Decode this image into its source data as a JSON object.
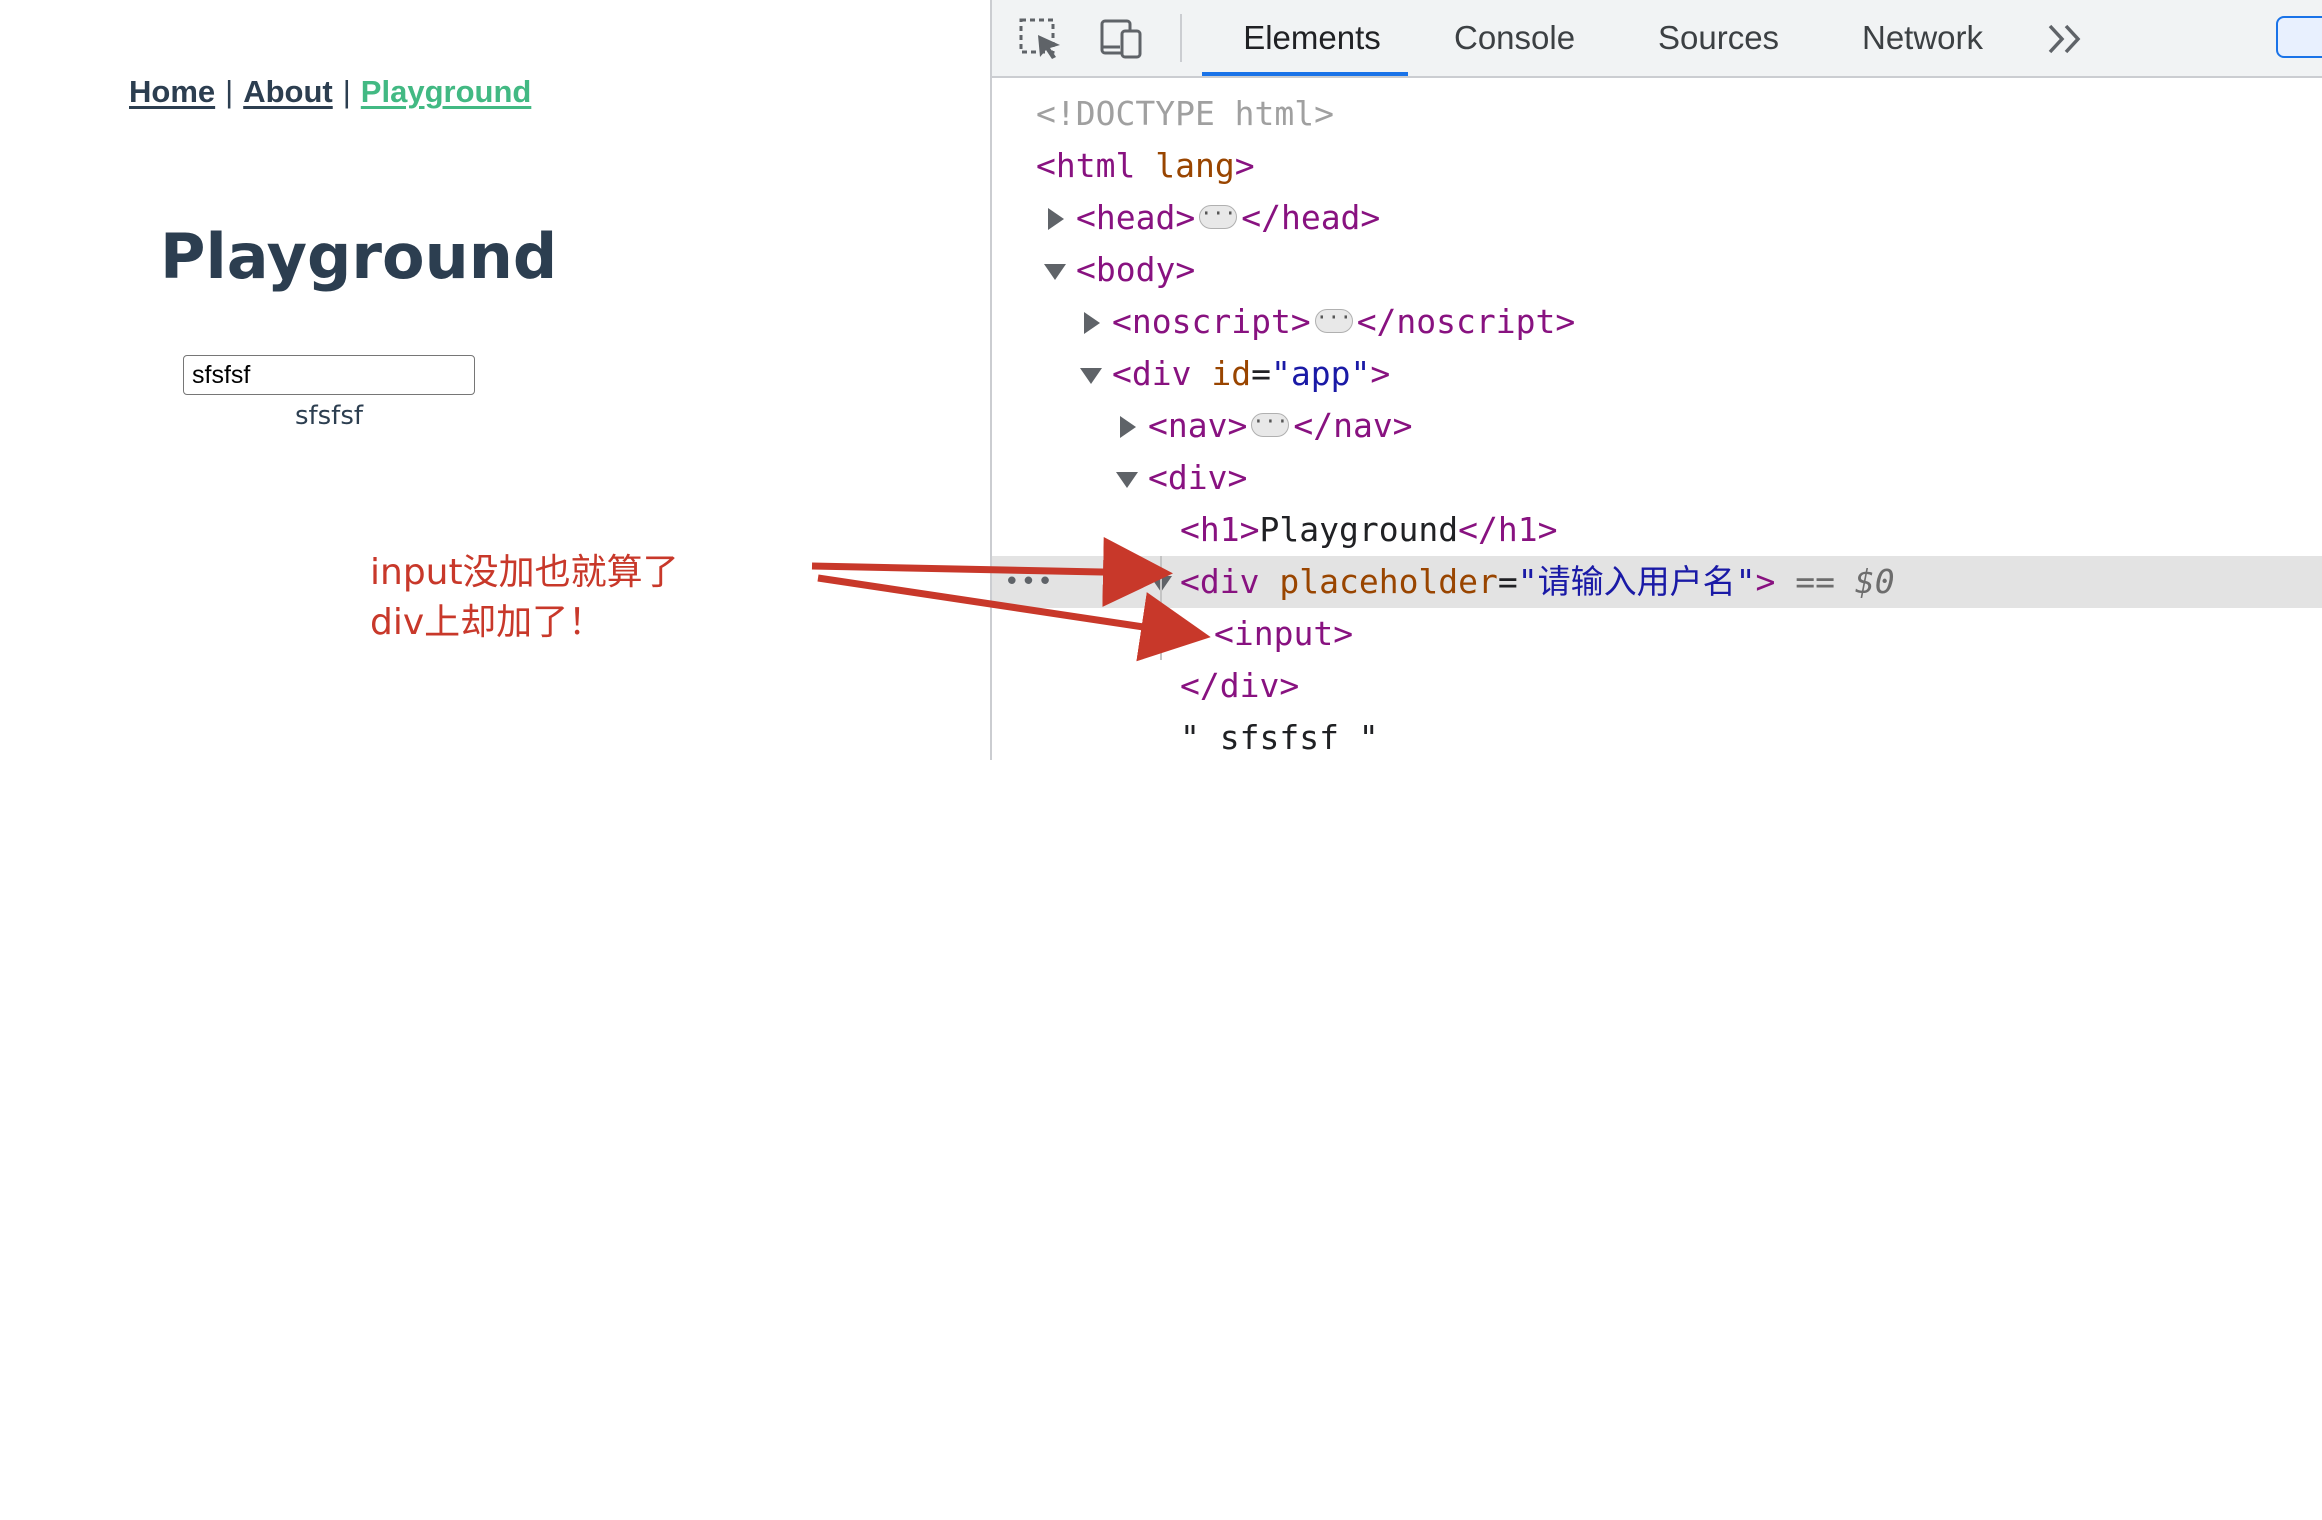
{
  "app": {
    "nav": {
      "home": "Home",
      "about": "About",
      "playground": "Playground",
      "separator": "|"
    },
    "title": "Playground",
    "input": {
      "value": "sfsfsf",
      "placeholder": ""
    },
    "echo": "sfsfsf"
  },
  "annotation": {
    "line1": "input没加也就算了",
    "line2": "div上却加了！",
    "color": "#c8382a"
  },
  "devtools": {
    "tabs": {
      "elements": "Elements",
      "console": "Console",
      "sources": "Sources",
      "network": "Network"
    },
    "dom": {
      "doctype": "<!DOCTYPE html>",
      "html_open": "<html",
      "html_attr": "lang",
      "html_close": ">",
      "head_open": "<head>",
      "head_close": "</head>",
      "body_open": "<body>",
      "noscript_open": "<noscript>",
      "noscript_close": "</noscript>",
      "div_open": "<div",
      "div_app_attr": "id",
      "div_app_val": "\"app\"",
      "gt": ">",
      "nav_open": "<nav>",
      "nav_close": "</nav>",
      "div_plain": "<div>",
      "h1_open": "<h1>",
      "h1_text": "Playground",
      "h1_close": "</h1>",
      "placeholder_attr": "placeholder",
      "placeholder_val": "\"请输入用户名\"",
      "selected_marker": "== ",
      "selected_var": "$0",
      "input_tag": "<input>",
      "div_close": "</div>",
      "text_node": "\" sfsfsf \"",
      "eq": "="
    },
    "colors": {
      "accent": "#1a73e8",
      "tag": "#881280",
      "attr": "#994500",
      "value": "#1a1aa6"
    }
  }
}
